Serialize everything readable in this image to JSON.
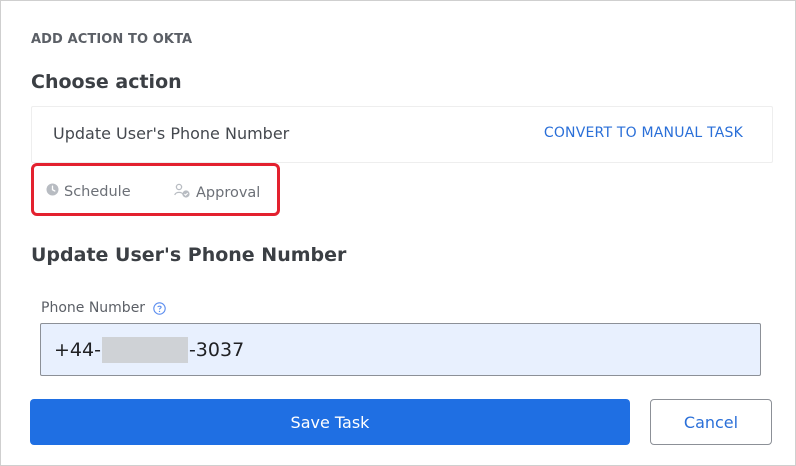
{
  "header": {
    "eyebrow": "ADD ACTION TO OKTA",
    "choose_title": "Choose action"
  },
  "action_card": {
    "name": "Update User's Phone Number",
    "convert_link": "CONVERT TO MANUAL TASK"
  },
  "options": {
    "schedule": {
      "label": "Schedule",
      "icon": "clock-icon"
    },
    "approval": {
      "label": "Approval",
      "icon": "approval-users-icon"
    }
  },
  "form": {
    "title": "Update User's Phone Number",
    "phone": {
      "label": "Phone Number",
      "value_prefix": "+44-",
      "value_suffix": "-3037",
      "help_icon": "help-icon"
    }
  },
  "buttons": {
    "save": "Save Task",
    "cancel": "Cancel"
  },
  "colors": {
    "primary": "#1f6fe3",
    "link": "#2a6fd8",
    "highlight_border": "#e3212f",
    "input_bg": "#e8f0fe"
  }
}
